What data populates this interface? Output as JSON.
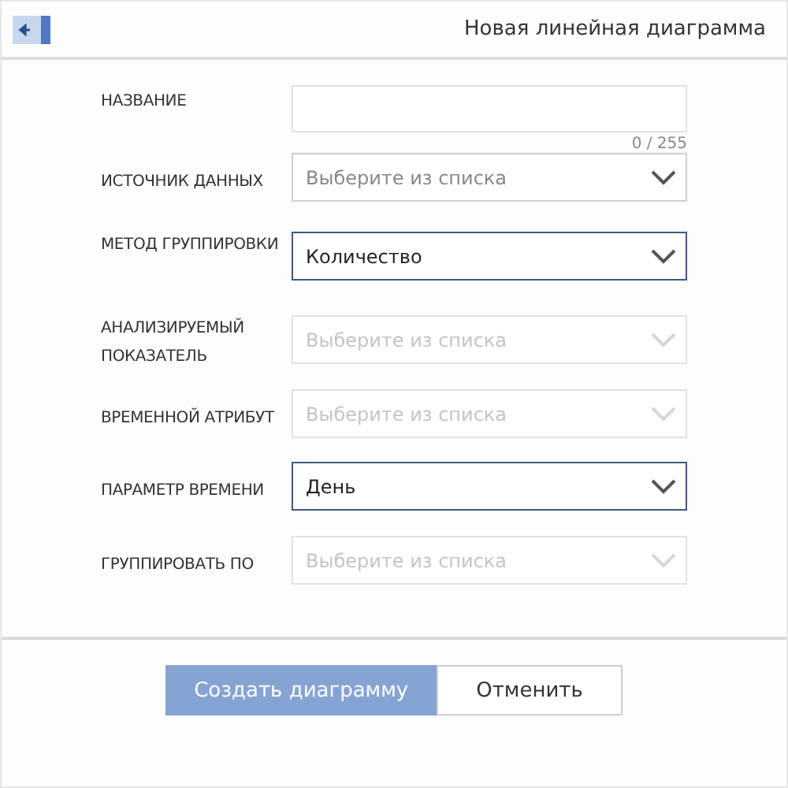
{
  "header": {
    "title": "Новая линейная диаграмма"
  },
  "fields": [
    {
      "kind": "text",
      "label": "НАЗВАНИЕ",
      "counter": "0 / 255"
    },
    {
      "kind": "select",
      "label": "ИСТОЧНИК ДАННЫХ",
      "placeholder": "Выберите из списка",
      "disabled": false,
      "focused": false
    },
    {
      "kind": "select",
      "label": "МЕТОД ГРУППИРОВКИ",
      "value": "Количество",
      "disabled": false,
      "focused": true
    },
    {
      "kind": "select",
      "label": "АНАЛИЗИРУЕМЫЙ ПОКАЗАТЕЛЬ",
      "placeholder": "Выберите из списка",
      "disabled": true,
      "focused": false
    },
    {
      "kind": "select",
      "label": "ВРЕМЕННОЙ АТРИБУТ",
      "placeholder": "Выберите из списка",
      "disabled": true,
      "focused": false
    },
    {
      "kind": "select",
      "label": "ПАРАМЕТР ВРЕМЕНИ",
      "value": "День",
      "disabled": false,
      "focused": true
    },
    {
      "kind": "select",
      "label": "ГРУППИРОВАТЬ ПО",
      "placeholder": "Выберите из списка",
      "disabled": true,
      "focused": false
    }
  ],
  "buttons": [
    {
      "kind": "primary",
      "label": "Создать диаграмму",
      "disabled": true
    },
    {
      "kind": "secondary",
      "label": "Отменить"
    }
  ]
}
